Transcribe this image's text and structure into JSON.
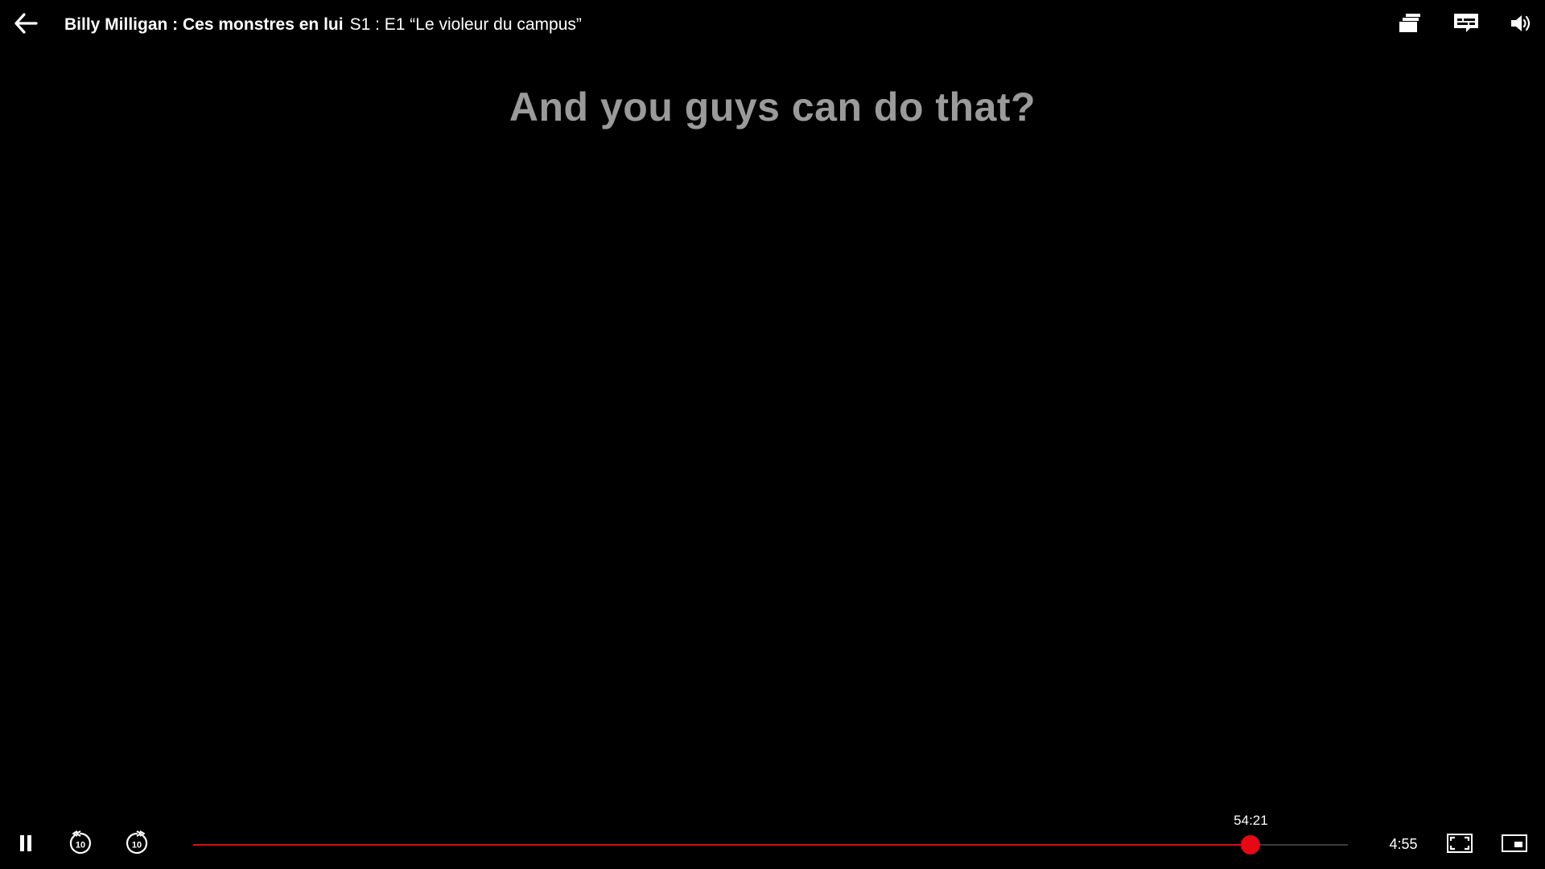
{
  "window": {
    "show_title": "Billy Milligan : Ces monstres en lui",
    "episode_info": "S1 : E1 “Le violeur du campus”"
  },
  "top_bar": {
    "icons": [
      "back-arrow-icon",
      "episodes-icon",
      "subtitles-icon",
      "volume-icon"
    ]
  },
  "subtitle": {
    "text": "And you guys can do that?"
  },
  "controls": {
    "icons": [
      "pause-icon",
      "rewind-10-icon",
      "forward-10-icon",
      "fullscreen-icon",
      "mini-player-icon"
    ],
    "skip_seconds": "10",
    "hover_time": "54:21",
    "remaining_time": "4:55",
    "progress_fraction": 0.916
  },
  "colors": {
    "accent": "#e50914",
    "background": "#000000",
    "subtitle_text": "#9a9a9a",
    "track": "#3c3c3c"
  }
}
